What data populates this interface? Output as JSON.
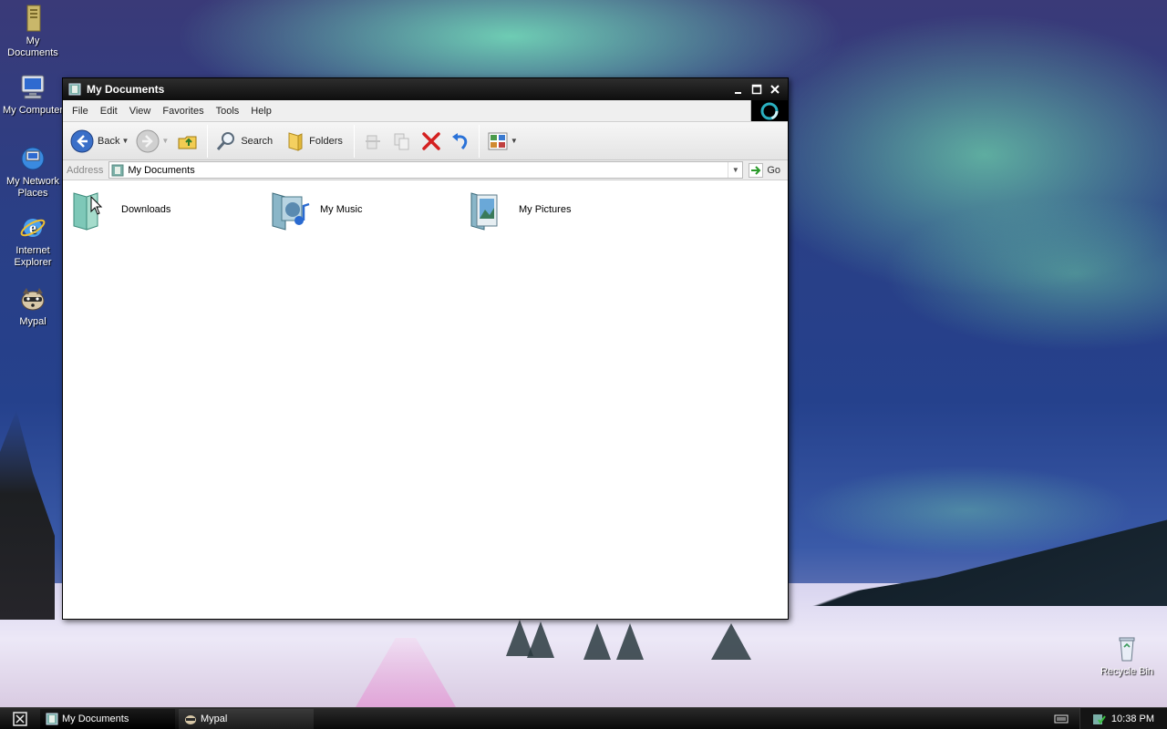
{
  "desktop": {
    "icons": [
      {
        "label": "My Documents"
      },
      {
        "label": "My Computer"
      },
      {
        "label": "My Network Places"
      },
      {
        "label": "Internet Explorer"
      },
      {
        "label": "Mypal"
      },
      {
        "label": "Recycle Bin"
      }
    ]
  },
  "window": {
    "title": "My Documents",
    "menu": [
      "File",
      "Edit",
      "View",
      "Favorites",
      "Tools",
      "Help"
    ],
    "toolbar": {
      "back_label": "Back",
      "search_label": "Search",
      "folders_label": "Folders"
    },
    "address": {
      "label": "Address",
      "value": "My Documents",
      "go_label": "Go"
    },
    "items": [
      {
        "name": "Downloads",
        "icon": "folder-icon"
      },
      {
        "name": "My Music",
        "icon": "music-folder-icon"
      },
      {
        "name": "My Pictures",
        "icon": "pictures-folder-icon"
      }
    ]
  },
  "taskbar": {
    "tasks": [
      {
        "label": "My Documents",
        "active": true
      },
      {
        "label": "Mypal",
        "active": false
      }
    ],
    "clock": "10:38 PM"
  },
  "colors": {
    "titlebar": "#111111",
    "taskbar": "#0a0a0a",
    "content_bg": "#ffffff"
  }
}
